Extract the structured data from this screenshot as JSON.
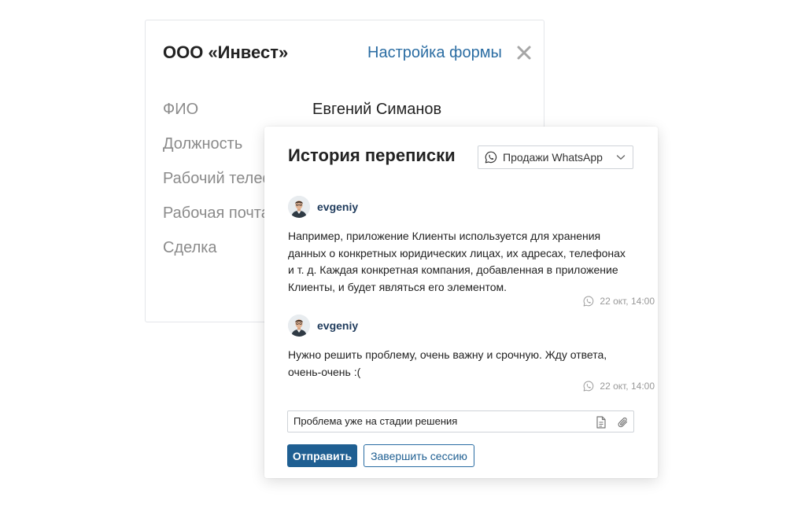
{
  "back_card": {
    "title": "ООО «Инвест»",
    "settings_link": "Настройка формы",
    "close_icon": "close-icon",
    "fields": [
      {
        "label": "ФИО",
        "value": "Евгений Симанов"
      },
      {
        "label": "Должность"
      },
      {
        "label": "Рабочий телефон"
      },
      {
        "label": "Рабочая почта"
      },
      {
        "label": "Сделка"
      }
    ]
  },
  "history": {
    "title": "История переписки",
    "channel": {
      "label": "Продажи WhatsApp",
      "icon": "whatsapp-icon"
    },
    "messages": [
      {
        "author": "evgeniy",
        "text": "Например, приложение Клиенты используется для хранения данных о конкретных юридических лицах, их адресах, телефонах и т. д. Каждая конкретная компания, добавленная в приложение Клиенты, и будет являться его элементом.",
        "time": "22 окт, 14:00"
      },
      {
        "author": "evgeniy",
        "text": "Нужно решить проблему, очень важну и срочную. Жду ответа, очень-очень  :(",
        "time": "22 окт, 14:00"
      }
    ],
    "reply": {
      "value": "Проблема уже на стадии решения"
    },
    "send_label": "Отправить",
    "end_session_label": "Завершить сессию"
  },
  "colors": {
    "link": "#2b6da3",
    "primary_button": "#1f5f92",
    "author": "#1f3b5c",
    "label_gray": "#8b8b8b"
  }
}
